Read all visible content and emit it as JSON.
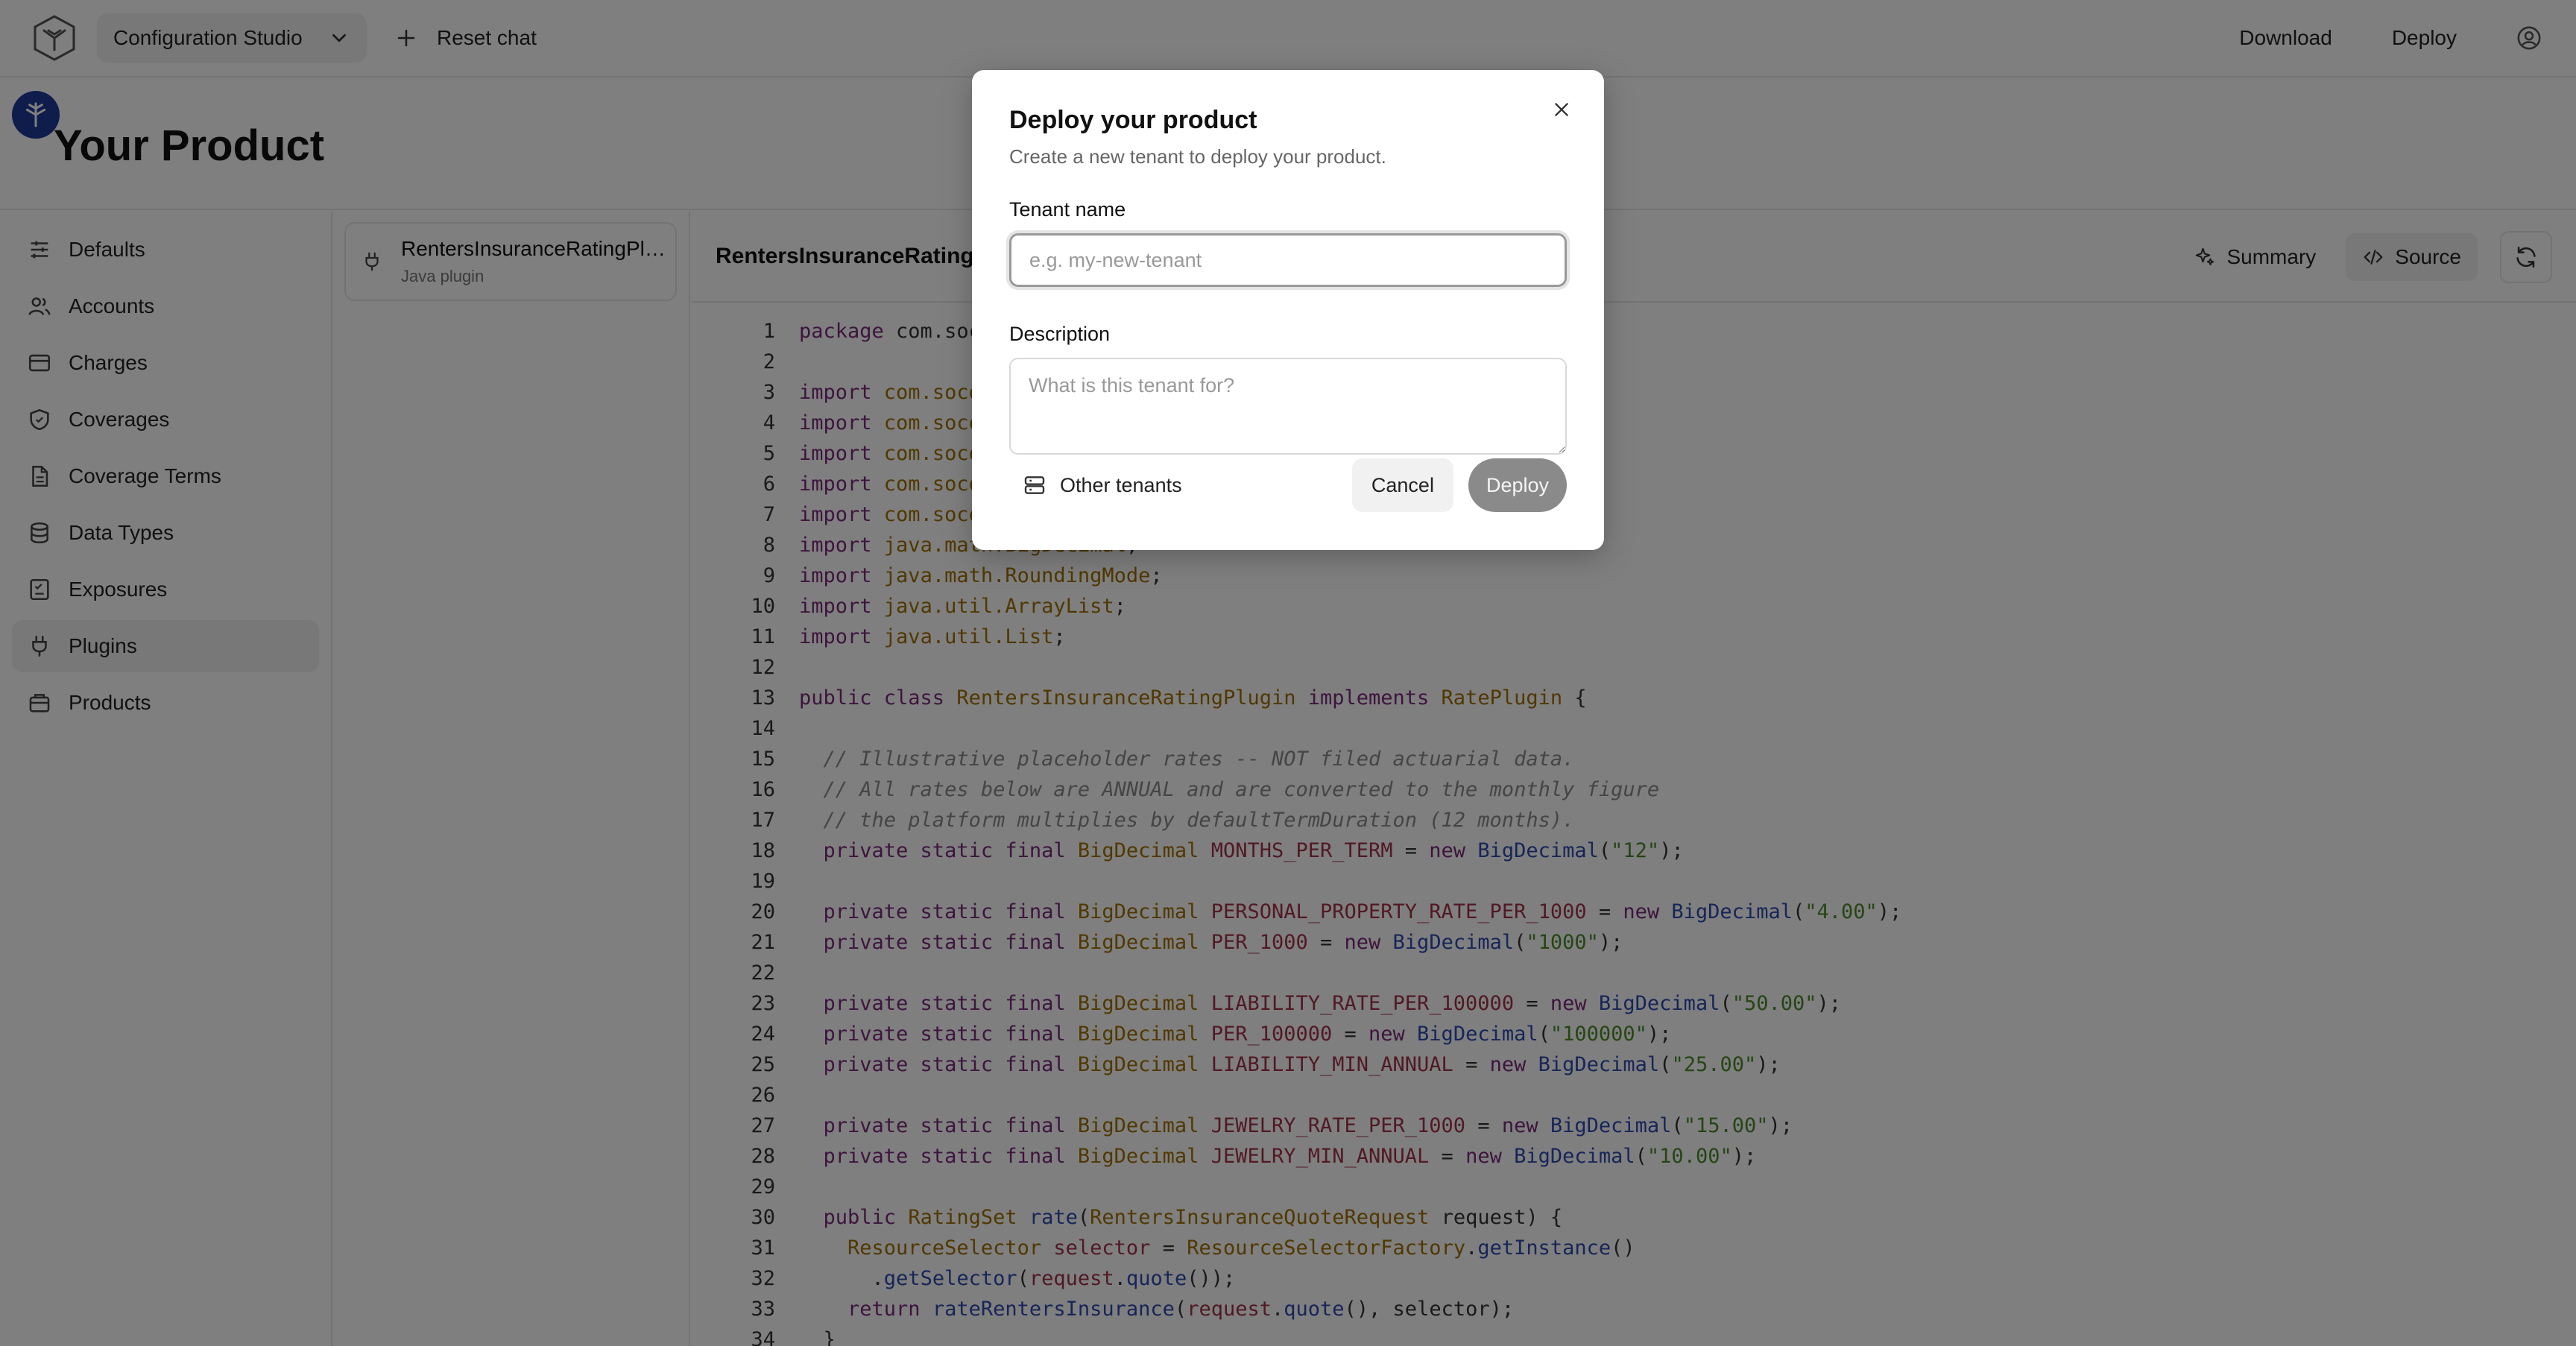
{
  "topbar": {
    "studio_label": "Configuration Studio",
    "reset_chat_label": "Reset chat",
    "download_label": "Download",
    "deploy_label": "Deploy"
  },
  "page_title": "Your Product",
  "sidebar": {
    "items": [
      {
        "label": "Defaults",
        "icon": "sliders-icon"
      },
      {
        "label": "Accounts",
        "icon": "users-icon"
      },
      {
        "label": "Charges",
        "icon": "credit-card-icon"
      },
      {
        "label": "Coverages",
        "icon": "shield-icon"
      },
      {
        "label": "Coverage Terms",
        "icon": "document-icon"
      },
      {
        "label": "Data Types",
        "icon": "database-icon"
      },
      {
        "label": "Exposures",
        "icon": "checklist-icon"
      },
      {
        "label": "Plugins",
        "icon": "plug-icon"
      },
      {
        "label": "Products",
        "icon": "package-icon"
      }
    ],
    "active": "Plugins"
  },
  "plugin_card": {
    "title": "RentersInsuranceRatingPlu...",
    "subtitle": "Java plugin"
  },
  "editor": {
    "title": "RentersInsuranceRating",
    "summary_label": "Summary",
    "source_label": "Source",
    "lines": [
      {
        "n": "1",
        "t": [
          [
            "kw",
            "package "
          ],
          [
            "pl",
            "com.soco"
          ]
        ]
      },
      {
        "n": "2",
        "t": []
      },
      {
        "n": "3",
        "t": [
          [
            "kw",
            "import "
          ],
          [
            "ty",
            "com.soco"
          ]
        ]
      },
      {
        "n": "4",
        "t": [
          [
            "kw",
            "import "
          ],
          [
            "ty",
            "com.soco"
          ]
        ]
      },
      {
        "n": "5",
        "t": [
          [
            "kw",
            "import "
          ],
          [
            "ty",
            "com.soco"
          ]
        ]
      },
      {
        "n": "6",
        "t": [
          [
            "kw",
            "import "
          ],
          [
            "ty",
            "com.soco"
          ]
        ]
      },
      {
        "n": "7",
        "t": [
          [
            "kw",
            "import "
          ],
          [
            "ty",
            "com.soco"
          ]
        ]
      },
      {
        "n": "8",
        "t": [
          [
            "kw",
            "import "
          ],
          [
            "ty",
            "java.math.BigDecimal"
          ],
          [
            "pl",
            ";"
          ]
        ]
      },
      {
        "n": "9",
        "t": [
          [
            "kw",
            "import "
          ],
          [
            "ty",
            "java.math.RoundingMode"
          ],
          [
            "pl",
            ";"
          ]
        ]
      },
      {
        "n": "10",
        "t": [
          [
            "kw",
            "import "
          ],
          [
            "ty",
            "java.util.ArrayList"
          ],
          [
            "pl",
            ";"
          ]
        ]
      },
      {
        "n": "11",
        "t": [
          [
            "kw",
            "import "
          ],
          [
            "ty",
            "java.util.List"
          ],
          [
            "pl",
            ";"
          ]
        ]
      },
      {
        "n": "12",
        "t": []
      },
      {
        "n": "13",
        "t": [
          [
            "kw",
            "public class "
          ],
          [
            "ty",
            "RentersInsuranceRatingPlugin "
          ],
          [
            "kw",
            "implements "
          ],
          [
            "ty",
            "RatePlugin "
          ],
          [
            "pl",
            "{"
          ]
        ]
      },
      {
        "n": "14",
        "t": []
      },
      {
        "n": "15",
        "t": [
          [
            "cm",
            "  // Illustrative placeholder rates -- NOT filed actuarial data."
          ]
        ]
      },
      {
        "n": "16",
        "t": [
          [
            "cm",
            "  // All rates below are ANNUAL and are converted to the monthly figure"
          ]
        ]
      },
      {
        "n": "17",
        "t": [
          [
            "cm",
            "  // the platform multiplies by defaultTermDuration (12 months)."
          ]
        ]
      },
      {
        "n": "18",
        "t": [
          [
            "kw",
            "  private static final "
          ],
          [
            "ty",
            "BigDecimal "
          ],
          [
            "co",
            "MONTHS_PER_TERM "
          ],
          [
            "pl",
            "= "
          ],
          [
            "kw",
            "new "
          ],
          [
            "fn",
            "BigDecimal"
          ],
          [
            "pl",
            "("
          ],
          [
            "st",
            "\"12\""
          ],
          [
            "pl",
            ");"
          ]
        ]
      },
      {
        "n": "19",
        "t": []
      },
      {
        "n": "20",
        "t": [
          [
            "kw",
            "  private static final "
          ],
          [
            "ty",
            "BigDecimal "
          ],
          [
            "co",
            "PERSONAL_PROPERTY_RATE_PER_1000 "
          ],
          [
            "pl",
            "= "
          ],
          [
            "kw",
            "new "
          ],
          [
            "fn",
            "BigDecimal"
          ],
          [
            "pl",
            "("
          ],
          [
            "st",
            "\"4.00\""
          ],
          [
            "pl",
            ");"
          ]
        ]
      },
      {
        "n": "21",
        "t": [
          [
            "kw",
            "  private static final "
          ],
          [
            "ty",
            "BigDecimal "
          ],
          [
            "co",
            "PER_1000 "
          ],
          [
            "pl",
            "= "
          ],
          [
            "kw",
            "new "
          ],
          [
            "fn",
            "BigDecimal"
          ],
          [
            "pl",
            "("
          ],
          [
            "st",
            "\"1000\""
          ],
          [
            "pl",
            ");"
          ]
        ]
      },
      {
        "n": "22",
        "t": []
      },
      {
        "n": "23",
        "t": [
          [
            "kw",
            "  private static final "
          ],
          [
            "ty",
            "BigDecimal "
          ],
          [
            "co",
            "LIABILITY_RATE_PER_100000 "
          ],
          [
            "pl",
            "= "
          ],
          [
            "kw",
            "new "
          ],
          [
            "fn",
            "BigDecimal"
          ],
          [
            "pl",
            "("
          ],
          [
            "st",
            "\"50.00\""
          ],
          [
            "pl",
            ");"
          ]
        ]
      },
      {
        "n": "24",
        "t": [
          [
            "kw",
            "  private static final "
          ],
          [
            "ty",
            "BigDecimal "
          ],
          [
            "co",
            "PER_100000 "
          ],
          [
            "pl",
            "= "
          ],
          [
            "kw",
            "new "
          ],
          [
            "fn",
            "BigDecimal"
          ],
          [
            "pl",
            "("
          ],
          [
            "st",
            "\"100000\""
          ],
          [
            "pl",
            ");"
          ]
        ]
      },
      {
        "n": "25",
        "t": [
          [
            "kw",
            "  private static final "
          ],
          [
            "ty",
            "BigDecimal "
          ],
          [
            "co",
            "LIABILITY_MIN_ANNUAL "
          ],
          [
            "pl",
            "= "
          ],
          [
            "kw",
            "new "
          ],
          [
            "fn",
            "BigDecimal"
          ],
          [
            "pl",
            "("
          ],
          [
            "st",
            "\"25.00\""
          ],
          [
            "pl",
            ");"
          ]
        ]
      },
      {
        "n": "26",
        "t": []
      },
      {
        "n": "27",
        "t": [
          [
            "kw",
            "  private static final "
          ],
          [
            "ty",
            "BigDecimal "
          ],
          [
            "co",
            "JEWELRY_RATE_PER_1000 "
          ],
          [
            "pl",
            "= "
          ],
          [
            "kw",
            "new "
          ],
          [
            "fn",
            "BigDecimal"
          ],
          [
            "pl",
            "("
          ],
          [
            "st",
            "\"15.00\""
          ],
          [
            "pl",
            ");"
          ]
        ]
      },
      {
        "n": "28",
        "t": [
          [
            "kw",
            "  private static final "
          ],
          [
            "ty",
            "BigDecimal "
          ],
          [
            "co",
            "JEWELRY_MIN_ANNUAL "
          ],
          [
            "pl",
            "= "
          ],
          [
            "kw",
            "new "
          ],
          [
            "fn",
            "BigDecimal"
          ],
          [
            "pl",
            "("
          ],
          [
            "st",
            "\"10.00\""
          ],
          [
            "pl",
            ");"
          ]
        ]
      },
      {
        "n": "29",
        "t": []
      },
      {
        "n": "30",
        "t": [
          [
            "kw",
            "  public "
          ],
          [
            "ty",
            "RatingSet "
          ],
          [
            "fn",
            "rate"
          ],
          [
            "pl",
            "("
          ],
          [
            "ty",
            "RentersInsuranceQuoteRequest "
          ],
          [
            "pl",
            "request) {"
          ]
        ]
      },
      {
        "n": "31",
        "t": [
          [
            "ty",
            "    ResourceSelector "
          ],
          [
            "co",
            "selector "
          ],
          [
            "pl",
            "= "
          ],
          [
            "ty",
            "ResourceSelectorFactory"
          ],
          [
            "pl",
            "."
          ],
          [
            "fn",
            "getInstance"
          ],
          [
            "pl",
            "()"
          ]
        ]
      },
      {
        "n": "32",
        "t": [
          [
            "pl",
            "      ."
          ],
          [
            "fn",
            "getSelector"
          ],
          [
            "pl",
            "("
          ],
          [
            "co",
            "request"
          ],
          [
            "pl",
            "."
          ],
          [
            "fn",
            "quote"
          ],
          [
            "pl",
            "());"
          ]
        ]
      },
      {
        "n": "33",
        "t": [
          [
            "kw",
            "    return "
          ],
          [
            "fn",
            "rateRentersInsurance"
          ],
          [
            "pl",
            "("
          ],
          [
            "co",
            "request"
          ],
          [
            "pl",
            "."
          ],
          [
            "fn",
            "quote"
          ],
          [
            "pl",
            "(), selector);"
          ]
        ]
      },
      {
        "n": "34",
        "t": [
          [
            "pl",
            "  }"
          ]
        ]
      }
    ]
  },
  "modal": {
    "title": "Deploy your product",
    "subtitle": "Create a new tenant to deploy your product.",
    "tenant_label": "Tenant name",
    "tenant_placeholder": "e.g. my-new-tenant",
    "description_label": "Description",
    "description_placeholder": "What is this tenant for?",
    "other_tenants_label": "Other tenants",
    "cancel_label": "Cancel",
    "deploy_label": "Deploy"
  }
}
